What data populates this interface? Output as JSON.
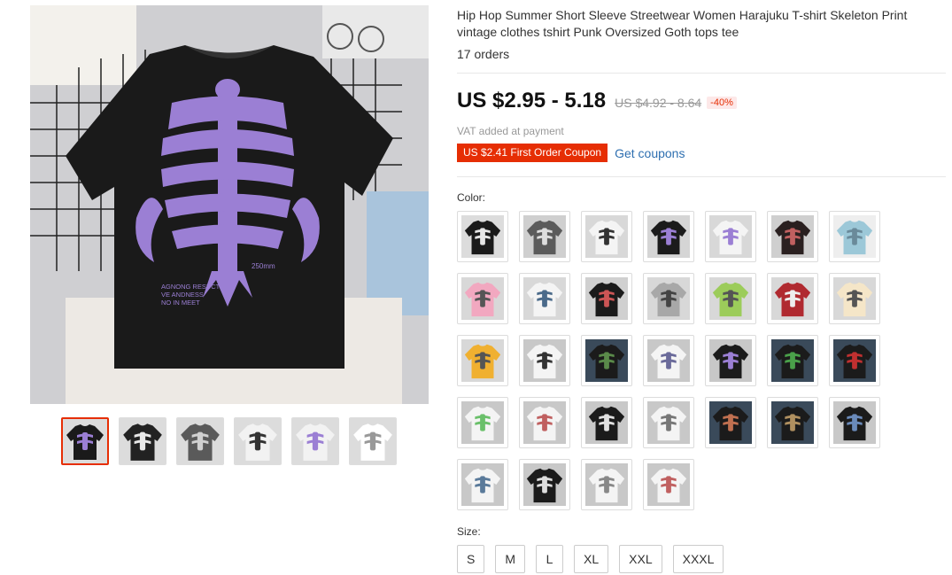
{
  "product": {
    "title": "Hip Hop Summer Short Sleeve Streetwear Women Harajuku T-shirt Skeleton Print vintage clothes tshirt Punk Oversized Goth tops tee",
    "orders": "17 orders",
    "price": "US $2.95 - 5.18",
    "original_price": "US $4.92 - 8.64",
    "discount": "-40%",
    "vat_note": "VAT added at payment",
    "coupon": "US $2.41 First Order Coupon",
    "get_coupons": "Get coupons"
  },
  "main_image": {
    "print_text_1": "AGNONG RESUCT",
    "print_text_2": "VE ANDNESS",
    "print_text_3": "NO IN MEET",
    "print_size_text": "250mm"
  },
  "colors_label": "Color:",
  "sizes_label": "Size:",
  "sizes": [
    "S",
    "M",
    "L",
    "XL",
    "XXL",
    "XXXL"
  ],
  "thumbnails": [
    {
      "shirt": "#1a1a1a",
      "print": "#9b7fd4"
    },
    {
      "shirt": "#222222",
      "print": "#e8e8e8"
    },
    {
      "shirt": "#5a5a5a",
      "print": "#d0d0d0"
    },
    {
      "shirt": "#f2f2f2",
      "print": "#333333"
    },
    {
      "shirt": "#f2f2f2",
      "print": "#9b7fd4"
    },
    {
      "shirt": "#ffffff",
      "print": "#999999"
    }
  ],
  "swatches": [
    {
      "bg": "#dcdcdc",
      "shirt": "#1b1b1b",
      "print": "#e6e6e6"
    },
    {
      "bg": "#cfcfcf",
      "shirt": "#5b5b5b",
      "print": "#dddddd"
    },
    {
      "bg": "#d8d8d8",
      "shirt": "#f4f4f4",
      "print": "#333333"
    },
    {
      "bg": "#d5d5d5",
      "shirt": "#1b1b1b",
      "print": "#9b7fd4"
    },
    {
      "bg": "#d8d8d8",
      "shirt": "#f4f4f4",
      "print": "#9b7fd4"
    },
    {
      "bg": "#cfcfcf",
      "shirt": "#2a2020",
      "print": "#c06060"
    },
    {
      "bg": "#eeeeee",
      "shirt": "#9cc8d8",
      "print": "#6a8a9a"
    },
    {
      "bg": "#d8d8d8",
      "shirt": "#f2a8c0",
      "print": "#555555"
    },
    {
      "bg": "#d8d8d8",
      "shirt": "#f4f4f4",
      "print": "#4a6a8a"
    },
    {
      "bg": "#d0d0d0",
      "shirt": "#1b1b1b",
      "print": "#cc5555"
    },
    {
      "bg": "#d8d8d8",
      "shirt": "#a8a8a8",
      "print": "#444444"
    },
    {
      "bg": "#d8d8d8",
      "shirt": "#9ccc5a",
      "print": "#555555"
    },
    {
      "bg": "#d8d8d8",
      "shirt": "#b02a30",
      "print": "#eeeeee"
    },
    {
      "bg": "#d8d8d8",
      "shirt": "#f5e6c8",
      "print": "#555555"
    },
    {
      "bg": "#d8d8d8",
      "shirt": "#f0b030",
      "print": "#555555"
    },
    {
      "bg": "#c8c8c8",
      "shirt": "#f4f4f4",
      "print": "#333333"
    },
    {
      "bg": "#3a4a5a",
      "shirt": "#1b1b1b",
      "print": "#5a8a4a"
    },
    {
      "bg": "#c8c8c8",
      "shirt": "#f4f4f4",
      "print": "#6a6a9a"
    },
    {
      "bg": "#c8c8c8",
      "shirt": "#1b1b1b",
      "print": "#9b7fd4"
    },
    {
      "bg": "#3a4a5a",
      "shirt": "#1b1b1b",
      "print": "#4aa04a"
    },
    {
      "bg": "#3a4a5a",
      "shirt": "#1b1b1b",
      "print": "#c03030"
    },
    {
      "bg": "#c8c8c8",
      "shirt": "#f4f4f4",
      "print": "#6ac06a"
    },
    {
      "bg": "#c8c8c8",
      "shirt": "#f4f4f4",
      "print": "#c06060"
    },
    {
      "bg": "#c8c8c8",
      "shirt": "#1b1b1b",
      "print": "#e0e0e0"
    },
    {
      "bg": "#c8c8c8",
      "shirt": "#f4f4f4",
      "print": "#777777"
    },
    {
      "bg": "#3a4a5a",
      "shirt": "#1b1b1b",
      "print": "#c07050"
    },
    {
      "bg": "#3a4a5a",
      "shirt": "#1b1b1b",
      "print": "#b09060"
    },
    {
      "bg": "#c8c8c8",
      "shirt": "#1b1b1b",
      "print": "#6a8aba"
    },
    {
      "bg": "#c8c8c8",
      "shirt": "#f4f4f4",
      "print": "#5a7a9a"
    },
    {
      "bg": "#c8c8c8",
      "shirt": "#1b1b1b",
      "print": "#dddddd"
    },
    {
      "bg": "#c8c8c8",
      "shirt": "#f4f4f4",
      "print": "#888888"
    },
    {
      "bg": "#c8c8c8",
      "shirt": "#f4f4f4",
      "print": "#c06060"
    }
  ]
}
